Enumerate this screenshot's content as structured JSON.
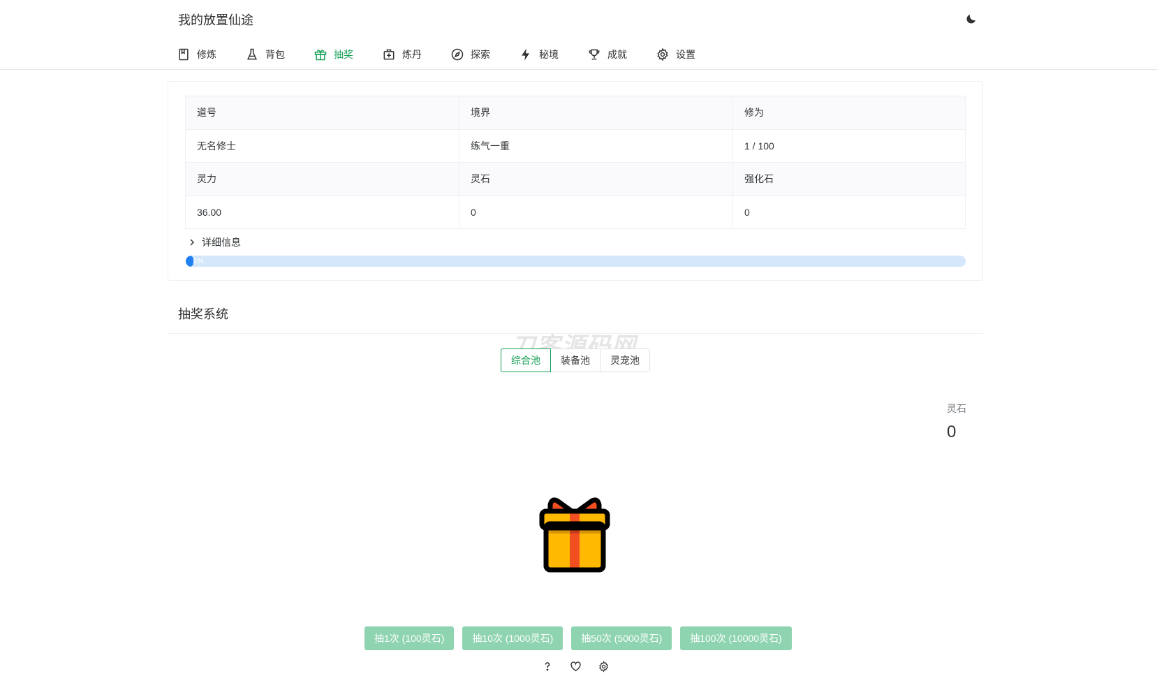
{
  "header": {
    "title": "我的放置仙途",
    "theme_icon": "moon-icon"
  },
  "nav": {
    "active": "抽奖",
    "items": [
      {
        "label": "修炼",
        "icon": "book-icon"
      },
      {
        "label": "背包",
        "icon": "flask-icon"
      },
      {
        "label": "抽奖",
        "icon": "gift-icon"
      },
      {
        "label": "炼丹",
        "icon": "medical-bag-icon"
      },
      {
        "label": "探索",
        "icon": "compass-icon"
      },
      {
        "label": "秘境",
        "icon": "lightning-icon"
      },
      {
        "label": "成就",
        "icon": "trophy-icon"
      },
      {
        "label": "设置",
        "icon": "gear-icon"
      }
    ]
  },
  "stats": {
    "headers_1": [
      "道号",
      "境界",
      "修为"
    ],
    "values_1": [
      "无名修士",
      "练气一重",
      "1 / 100"
    ],
    "headers_2": [
      "灵力",
      "灵石",
      "强化石"
    ],
    "values_2": [
      "36.00",
      "0",
      "0"
    ],
    "details_label": "详细信息",
    "progress_percent": 1,
    "progress_text": "1%"
  },
  "lottery": {
    "title": "抽奖系统",
    "watermark": "刀客源码网",
    "pools": [
      "综合池",
      "装备池",
      "灵宠池"
    ],
    "active_pool": "综合池",
    "stone_label": "灵石",
    "stone_value": "0",
    "gift_icon": "gift-box-icon",
    "draw_buttons": [
      "抽1次 (100灵石)",
      "抽10次 (1000灵石)",
      "抽50次 (5000灵石)",
      "抽100次 (10000灵石)"
    ],
    "tool_icons": [
      "question-icon",
      "heart-icon",
      "gear-icon"
    ]
  },
  "colors": {
    "accent": "#18a058",
    "accent_disabled": "#8fd4b0",
    "progress": "#2080f0",
    "progress_track": "#d4e7fb"
  }
}
